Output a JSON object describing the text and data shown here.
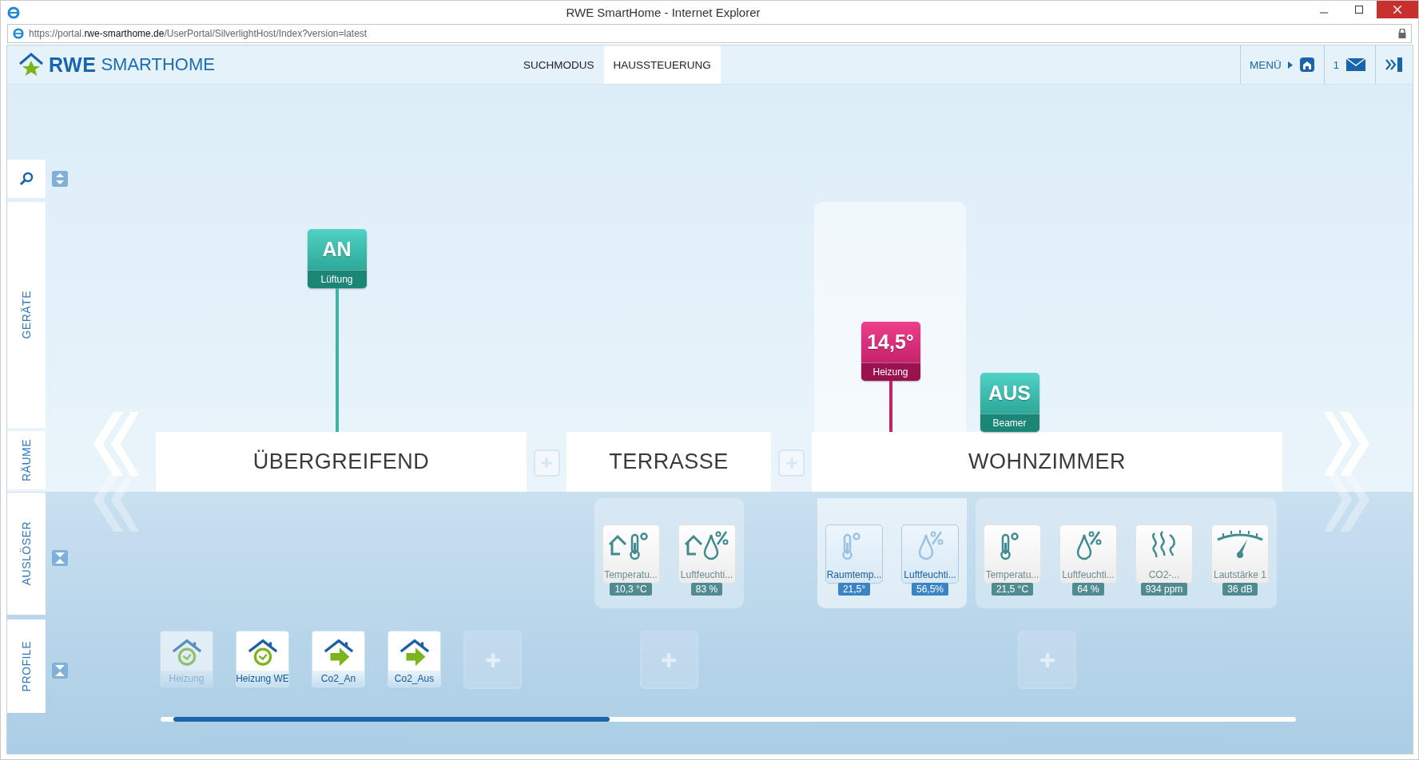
{
  "window": {
    "title": "RWE SmartHome - Internet Explorer"
  },
  "address_bar": {
    "url_prefix": "https://portal.",
    "url_domain": "rwe-smarthome.de",
    "url_path": "/UserPortal/SilverlightHost/Index?version=latest"
  },
  "header": {
    "logo_brand": "RWE",
    "logo_product": "SMARTHOME",
    "menu": "MENÜ",
    "message_count": "1"
  },
  "nav_tabs": [
    {
      "label": "SUCHMODUS",
      "selected": false
    },
    {
      "label": "HAUSSTEUERUNG",
      "selected": true
    }
  ],
  "sidebar": {
    "sections": [
      {
        "label": "GERÄTE"
      },
      {
        "label": "RÄUME"
      },
      {
        "label": "AUSLÖSER"
      },
      {
        "label": "PROFILE"
      }
    ]
  },
  "rooms": [
    {
      "name": "ÜBERGREIFEND",
      "devices": [
        {
          "kind": "switch",
          "value": "AN",
          "label": "Lüftung"
        }
      ],
      "profiles": [
        {
          "kind": "schedule",
          "label": "Heizung",
          "disabled": true
        },
        {
          "kind": "schedule",
          "label": "Heizung WE",
          "disabled": false
        },
        {
          "kind": "action",
          "label": "Co2_An",
          "disabled": false
        },
        {
          "kind": "action",
          "label": "Co2_Aus",
          "disabled": false
        }
      ]
    },
    {
      "name": "TERRASSE",
      "trigger_groups": [
        {
          "selected": false,
          "triggers": [
            {
              "kind": "outdoor_temperature",
              "label": "Temperatu...",
              "value": "10,3 °C"
            },
            {
              "kind": "outdoor_humidity",
              "label": "Luftfeuchti...",
              "value": "83 %"
            }
          ]
        }
      ]
    },
    {
      "name": "WOHNZIMMER",
      "devices": [
        {
          "kind": "thermostat",
          "value": "14,5°",
          "label": "Heizung"
        },
        {
          "kind": "switch",
          "value": "AUS",
          "label": "Beamer"
        }
      ],
      "trigger_groups": [
        {
          "selected": true,
          "triggers": [
            {
              "kind": "temperature",
              "label": "Raumtemp...",
              "value": "21,5°"
            },
            {
              "kind": "humidity",
              "label": "Luftfeuchti...",
              "value": "56,5%"
            }
          ]
        },
        {
          "selected": false,
          "triggers": [
            {
              "kind": "temperature",
              "label": "Temperatu...",
              "value": "21,5 °C"
            },
            {
              "kind": "humidity",
              "label": "Luftfeuchti...",
              "value": "64 %"
            },
            {
              "kind": "co2",
              "label": "CO2-...",
              "value": "934 ppm"
            },
            {
              "kind": "volume",
              "label": "Lautstärke 1",
              "value": "36 dB"
            }
          ]
        }
      ]
    }
  ]
}
